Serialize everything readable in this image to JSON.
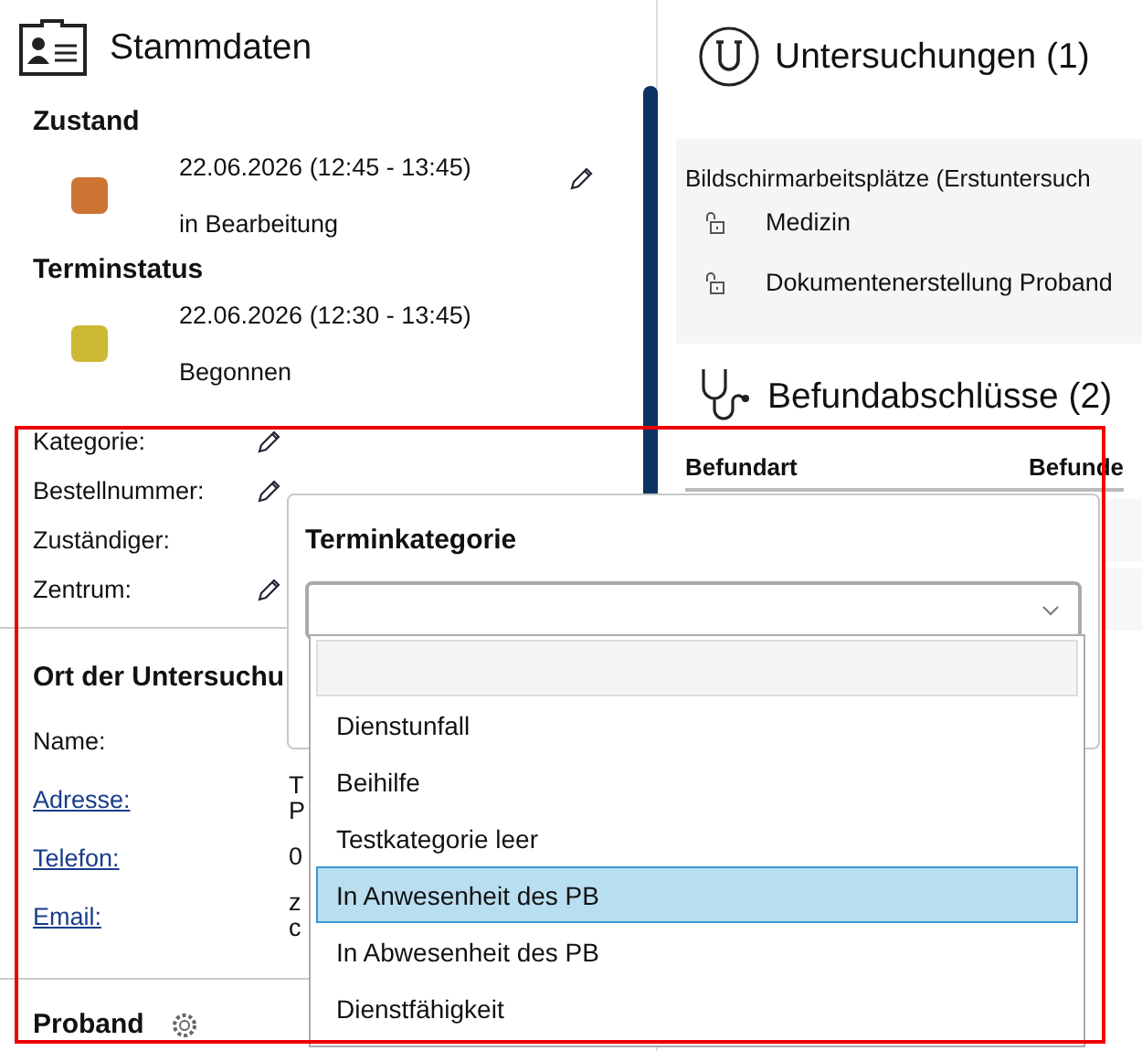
{
  "stammdaten": {
    "title": "Stammdaten",
    "zustand": {
      "heading": "Zustand",
      "color": "#cc7433",
      "date": "22.06.2026 (12:45 - 13:45)",
      "status": "in Bearbeitung",
      "editable": true
    },
    "terminstatus": {
      "heading": "Terminstatus",
      "color": "#cdb833",
      "date": "22.06.2026 (12:30 - 13:45)",
      "status": "Begonnen",
      "editable": false
    },
    "fields": [
      {
        "label": "Kategorie:",
        "editable": true
      },
      {
        "label": "Bestellnummer:",
        "editable": true
      },
      {
        "label": "Zuständiger:",
        "editable": false
      },
      {
        "label": "Zentrum:",
        "editable": true
      }
    ],
    "ort": {
      "heading": "Ort der Untersuchu",
      "rows": [
        {
          "label": "Name:",
          "link": false,
          "values": []
        },
        {
          "label": "Adresse:",
          "link": true,
          "values": [
            "T",
            "P"
          ]
        },
        {
          "label": "Telefon:",
          "link": true,
          "values": [
            "0"
          ]
        },
        {
          "label": "Email:",
          "link": true,
          "values": [
            "z",
            "c"
          ]
        }
      ]
    },
    "proband": {
      "heading": "Proband"
    }
  },
  "untersuchungen": {
    "title": "Untersuchungen (1)",
    "group": "Bildschirmarbeitsplätze (Erstuntersuch",
    "items": [
      {
        "label": "Medizin"
      },
      {
        "label": "Dokumentenerstellung Proband"
      }
    ]
  },
  "befundabschluesse": {
    "title": "Befundabschlüsse (2)",
    "columns": [
      "Befundart",
      "Befunde"
    ]
  },
  "popup": {
    "title": "Terminkategorie",
    "options": [
      {
        "selected": false
      },
      {
        "label": "Dienstunfall",
        "selected": false
      },
      {
        "label": "Beihilfe",
        "selected": false
      },
      {
        "label": "Testkategorie leer",
        "selected": false
      },
      {
        "label": "In Anwesenheit des PB",
        "selected": true
      },
      {
        "label": "In Abwesenheit des PB",
        "selected": false
      },
      {
        "label": "Dienstfähigkeit",
        "selected": false
      }
    ]
  }
}
